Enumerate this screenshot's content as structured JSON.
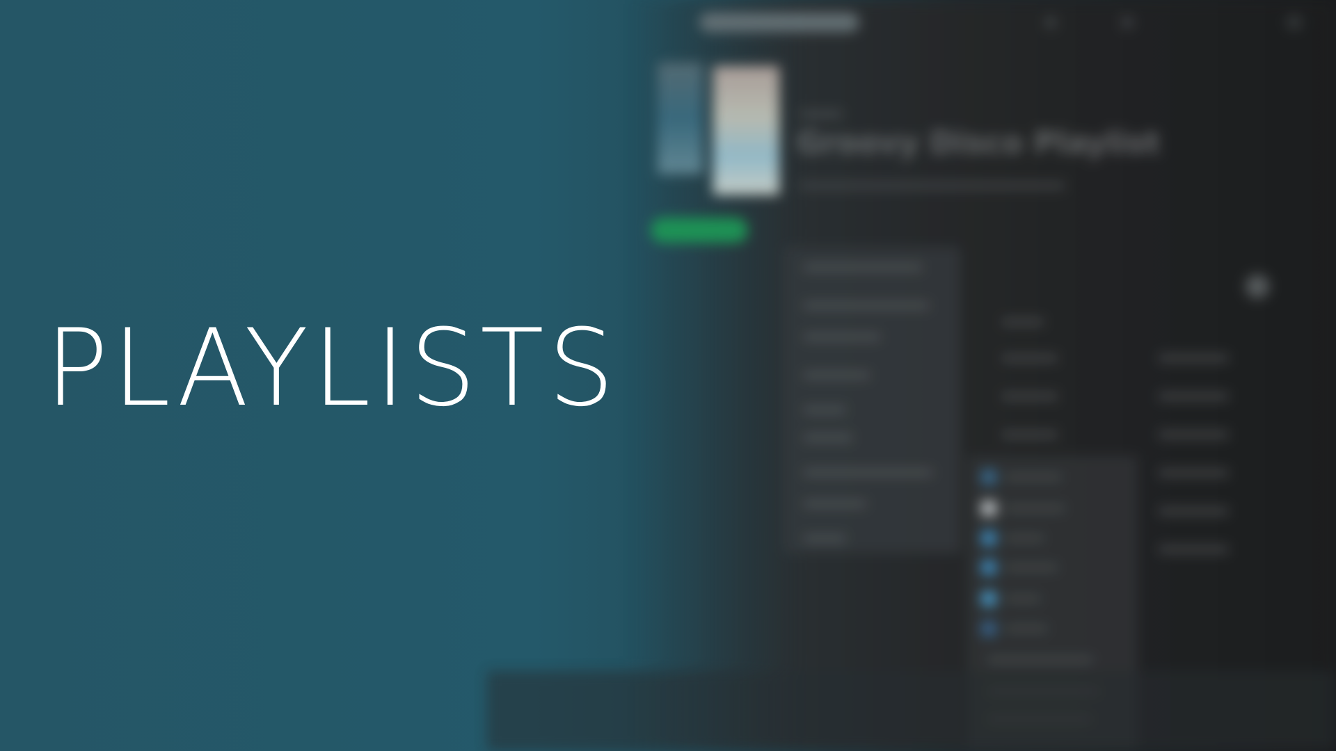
{
  "title": "PLAYLISTS",
  "background_app": {
    "playlist_title": "Groovy Disco Playlist"
  },
  "colors": {
    "background_teal": "#255666",
    "background_dark": "#1a1c1e",
    "title_text": "#ffffff",
    "accent_green": "#1d9a55"
  }
}
